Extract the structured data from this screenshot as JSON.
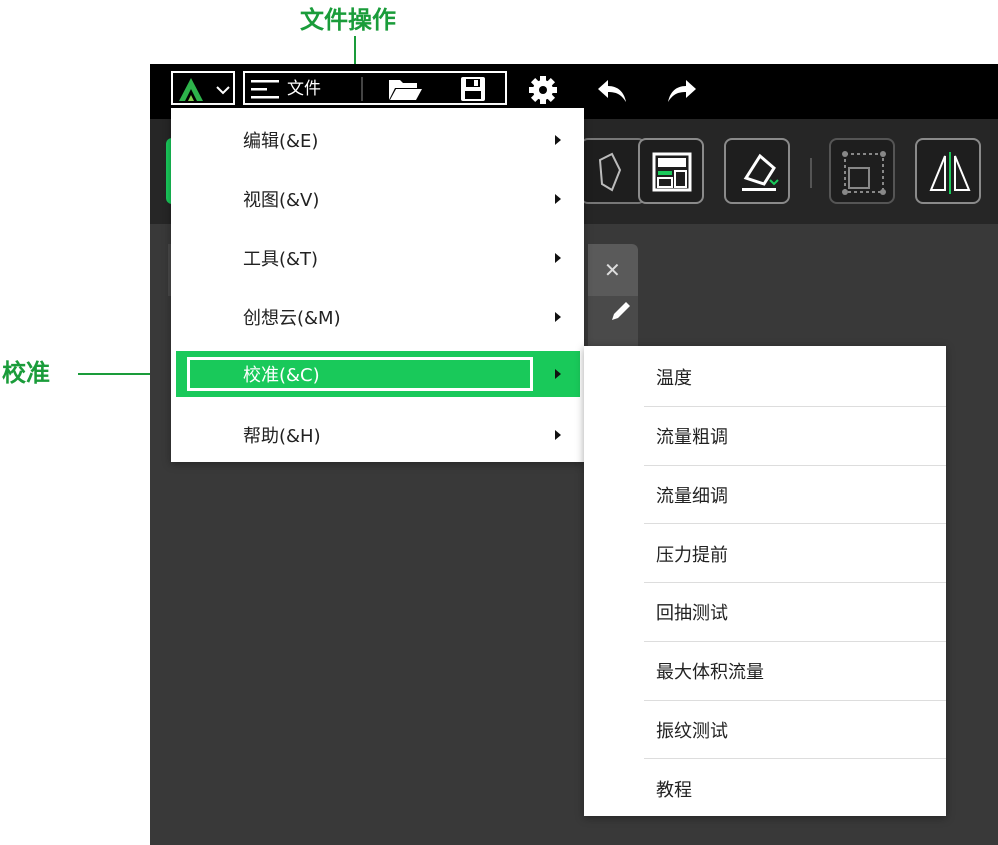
{
  "annotations": {
    "file_ops": "文件操作",
    "calibration": "校准"
  },
  "titlebar": {
    "file_label": "文件",
    "icons": [
      "logo-icon",
      "chevron-down-icon",
      "hamburger-icon",
      "folder-open-icon",
      "save-icon",
      "gear-icon",
      "undo-icon",
      "redo-icon"
    ]
  },
  "colors": {
    "accent": "#19c95a",
    "annotation": "#1a9c3a",
    "titlebar": "#000000",
    "toolbar": "#262626",
    "canvas": "#393939"
  },
  "menu": {
    "items": [
      {
        "label": "编辑(&E)"
      },
      {
        "label": "视图(&V)"
      },
      {
        "label": "工具(&T)"
      },
      {
        "label": "创想云(&M)"
      },
      {
        "label": "校准(&C)",
        "active": true
      },
      {
        "label": "帮助(&H)"
      }
    ]
  },
  "submenu": {
    "items": [
      {
        "label": "温度"
      },
      {
        "label": "流量粗调"
      },
      {
        "label": "流量细调"
      },
      {
        "label": "压力提前"
      },
      {
        "label": "回抽测试"
      },
      {
        "label": "最大体积流量"
      },
      {
        "label": "振纹测试"
      },
      {
        "label": "教程"
      }
    ]
  },
  "panel": {
    "close_symbol": "✕"
  }
}
